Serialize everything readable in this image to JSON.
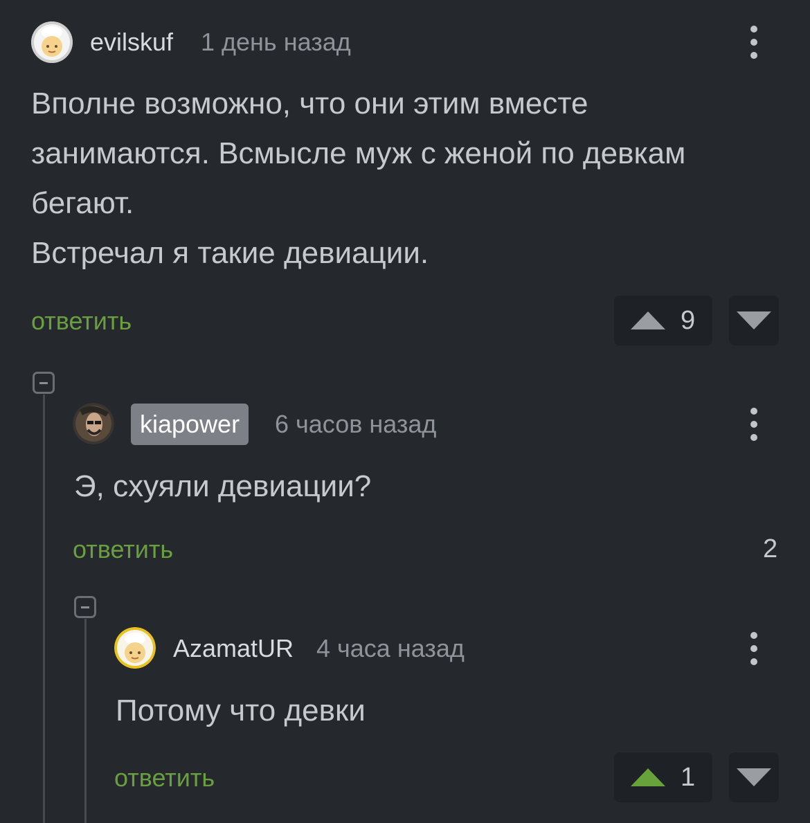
{
  "comments": [
    {
      "author": "evilskuf",
      "time": "1 день назад",
      "lines": [
        "Вполне возможно, что они этим вместе",
        "занимаются. Всмысле муж с женой по девкам",
        "бегают.",
        "Встречал я такие девиации."
      ],
      "reply_label": "ответить",
      "rating": "9"
    },
    {
      "author": "kiapower",
      "time": "6 часов назад",
      "lines": [
        "Э, схуяли девиации?"
      ],
      "reply_label": "ответить",
      "rating": "2"
    },
    {
      "author": "AzamatUR",
      "time": "4 часа назад",
      "lines": [
        "Потому что девки"
      ],
      "reply_label": "ответить",
      "rating": "1"
    }
  ],
  "colors": {
    "background": "#25282d",
    "reply_link": "#6a9f3f",
    "upvoted": "#67a23b",
    "author_badge": "#7d8187"
  },
  "icons": [
    "avatar-image",
    "more-options-icon",
    "upvote-icon",
    "downvote-icon",
    "collapse-thread-icon"
  ]
}
